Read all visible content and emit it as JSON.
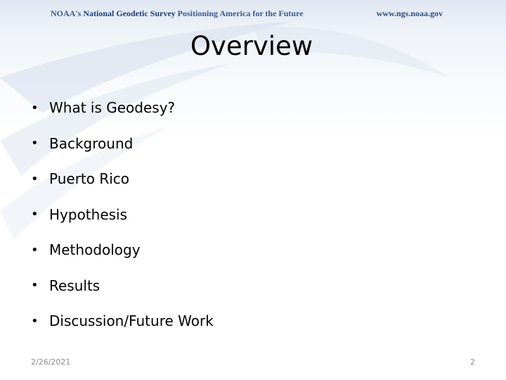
{
  "header": {
    "org_prefix": "NOAA's ",
    "org_name": "National Geodetic Survey",
    "tagline": " Positioning America for the Future",
    "url": "www.ngs.noaa.gov"
  },
  "slide": {
    "title": "Overview",
    "bullets": [
      "What is Geodesy?",
      "Background",
      "Puerto Rico",
      "Hypothesis",
      "Methodology",
      "Results",
      "Discussion/Future Work"
    ],
    "bullet_glyph": "•"
  },
  "footer": {
    "date": "2/26/2021",
    "page_number": "2"
  },
  "colors": {
    "header_text": "#3a5a8c",
    "header_ngs": "#1f3f74",
    "background_wash": "#dfe6f1"
  }
}
